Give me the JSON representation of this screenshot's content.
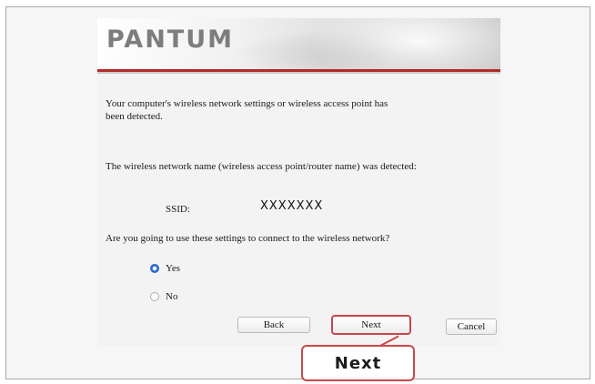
{
  "brand": {
    "logo_text": "PANTUM",
    "accent_color": "#b32a26"
  },
  "message": {
    "line1": "Your computer's wireless network settings or wireless access point has",
    "line1b": "been detected.",
    "line2": "The wireless network name (wireless access point/router name) was detected:",
    "ssid_label": "SSID:",
    "ssid_value": "XXXXXXX",
    "question": "Are you going to use these settings to connect to the wireless network?"
  },
  "options": [
    {
      "label": "Yes",
      "selected": true
    },
    {
      "label": "No",
      "selected": false
    }
  ],
  "buttons": {
    "back": "Back",
    "next": "Next",
    "cancel": "Cancel"
  },
  "annotation": {
    "callout_text": "Next",
    "highlight_color": "#c8474b"
  }
}
